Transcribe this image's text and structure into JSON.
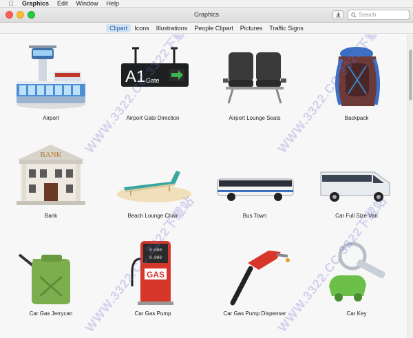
{
  "menubar": {
    "apple_icon": "apple-icon",
    "items": [
      "Graphics",
      "Edit",
      "Window",
      "Help"
    ]
  },
  "window": {
    "title": "Graphics",
    "search_placeholder": "Search"
  },
  "tabs": [
    {
      "label": "Clipart",
      "active": true
    },
    {
      "label": "Icons",
      "active": false
    },
    {
      "label": "Illustrations",
      "active": false
    },
    {
      "label": "People Clipart",
      "active": false
    },
    {
      "label": "Pictures",
      "active": false
    },
    {
      "label": "Traffic Signs",
      "active": false
    }
  ],
  "items": [
    {
      "label": "Airport",
      "icon": "airport-icon"
    },
    {
      "label": "Airport Gate Direction",
      "icon": "gate-sign-icon",
      "sign_text": "A1",
      "sign_sub": "Gate"
    },
    {
      "label": "Airport Lounge Seats",
      "icon": "lounge-seats-icon"
    },
    {
      "label": "Backpack",
      "icon": "backpack-icon"
    },
    {
      "label": "Bank",
      "icon": "bank-icon",
      "sign_text": "BANK"
    },
    {
      "label": "Beach Lounge Chair",
      "icon": "beach-chair-icon"
    },
    {
      "label": "Bus Town",
      "icon": "bus-icon"
    },
    {
      "label": "Car Full Size Van",
      "icon": "van-icon"
    },
    {
      "label": "Car Gas Jerrycan",
      "icon": "jerrycan-icon"
    },
    {
      "label": "Car Gas Pump",
      "icon": "gas-pump-icon",
      "sign_text": "GAS",
      "readout": "0.000"
    },
    {
      "label": "Car Gas Pump Dispenser",
      "icon": "pump-nozzle-icon"
    },
    {
      "label": "Car Key",
      "icon": "car-key-icon"
    }
  ],
  "watermark": "WWW.3322.CC 3322下载站"
}
